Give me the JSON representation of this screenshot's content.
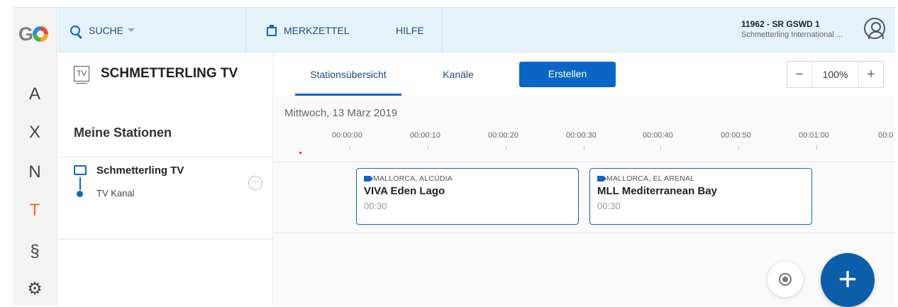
{
  "rail": {
    "logo": "G",
    "items": [
      {
        "glyph": "A",
        "icon": "a-icon",
        "color": "#444444"
      },
      {
        "glyph": "X",
        "icon": "x-icon",
        "color": "#444444"
      },
      {
        "glyph": "N",
        "icon": "n-icon",
        "color": "#444444"
      },
      {
        "glyph": "T",
        "icon": "t-icon",
        "color": "#f26b21"
      },
      {
        "glyph": "§",
        "icon": "paragraph-icon",
        "color": "#333333"
      },
      {
        "glyph": "⚙",
        "icon": "gear-icon",
        "color": "#333333"
      }
    ]
  },
  "topbar": {
    "search_label": "SUCHE",
    "bookmark_label": "MERKZETTEL",
    "help_label": "HILFE",
    "user_id": "11962 - SR GSWD 1",
    "user_company": "Schmetterling International ..."
  },
  "panel": {
    "tv_icon_text": "TV",
    "title": "SCHMETTERLING TV",
    "section_title": "Meine Stationen",
    "station_name": "Schmetterling TV",
    "channel_name": "TV Kanal",
    "more_glyph": "···"
  },
  "main": {
    "tabs": [
      {
        "label": "Stationsübersicht",
        "active": true
      },
      {
        "label": "Kanäle",
        "active": false
      }
    ],
    "create_label": "Erstellen",
    "zoom": {
      "minus": "−",
      "value": "100%",
      "plus": "+"
    },
    "date": "Mittwoch, 13 März 2019",
    "ticks": [
      "00:00:00",
      "00:00:10",
      "00:00:20",
      "00:00:30",
      "00:00:40",
      "00:00:50",
      "00:01:00",
      "00:0"
    ],
    "cards": [
      {
        "location": "MALLORCA, ALCÚDIA",
        "title": "VIVA Eden Lago",
        "duration": "00:30"
      },
      {
        "location": "MALLORCA, EL ARENAL",
        "title": "MLL Mediterranean Bay",
        "duration": "00:30"
      }
    ],
    "fab_plus": "+"
  },
  "colors": {
    "accent": "#0a66c2",
    "topbar_bg": "#e6f2fa",
    "active_rail": "#f26b21"
  }
}
